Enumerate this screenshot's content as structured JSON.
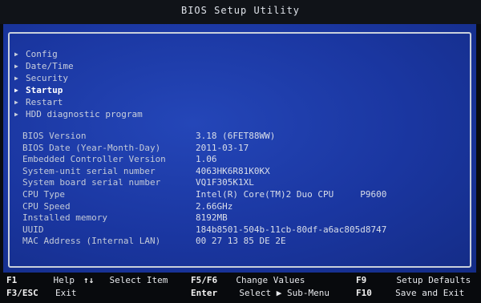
{
  "window": {
    "title": "BIOS Setup Utility"
  },
  "menu": {
    "items": [
      {
        "label": "Config"
      },
      {
        "label": "Date/Time"
      },
      {
        "label": "Security"
      },
      {
        "label": "Startup"
      },
      {
        "label": "Restart"
      },
      {
        "label": "HDD diagnostic program"
      }
    ],
    "selected_index": 3
  },
  "system_info": [
    {
      "label": "BIOS Version",
      "value": "3.18   (6FET88WW)"
    },
    {
      "label": "BIOS Date (Year-Month-Day)",
      "value": "2011-03-17"
    },
    {
      "label": "Embedded Controller Version",
      "value": "1.06"
    },
    {
      "label": "System-unit serial number",
      "value": "4063HK6R81K0KX"
    },
    {
      "label": "System board serial number",
      "value": "VQ1F305K1XL"
    },
    {
      "label": "CPU Type",
      "value": "Intel(R) Core(TM)2 Duo CPU     P9600"
    },
    {
      "label": "CPU Speed",
      "value": "2.66GHz"
    },
    {
      "label": "Installed memory",
      "value": "8192MB"
    },
    {
      "label": "UUID",
      "value": "184b8501-504b-11cb-80df-a6ac805d8747"
    },
    {
      "label": "MAC Address (Internal LAN)",
      "value": "00 27 13 85 DE 2E"
    }
  ],
  "help_bar": {
    "f1_key": "F1",
    "f1_label": "Help",
    "esc_key": "F3/ESC",
    "esc_label": "Exit",
    "updown_key": "↑↓",
    "updown_label": "Select Item",
    "leftright_label": "",
    "enter_key": "Enter",
    "enter_label": "Select ▶ Sub-Menu",
    "f5f6_key": "F5/F6",
    "f5f6_label": "Change Values",
    "f9_key": "F9",
    "f9_label": "Setup Defaults",
    "f10_key": "F10",
    "f10_label": "Save and Exit"
  },
  "colors": {
    "panel_background": "#1c3aa5",
    "text": "#d8dde8",
    "selected_text": "#ffffff"
  }
}
